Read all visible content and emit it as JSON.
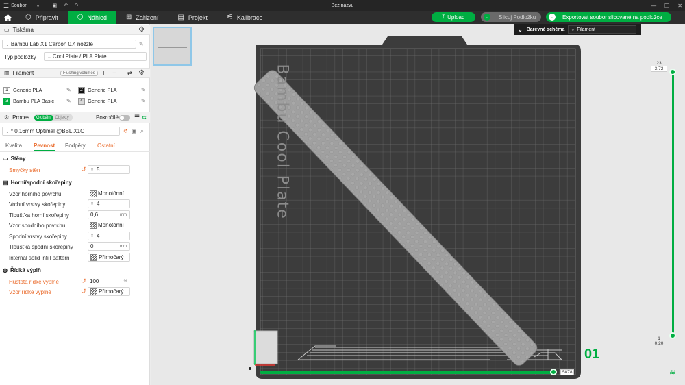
{
  "titlebar": {
    "menu_label": "Soubor",
    "title": "Bez názvu"
  },
  "tabs": [
    {
      "label": "Připravit",
      "icon": "prepare-icon"
    },
    {
      "label": "Náhled",
      "icon": "preview-icon"
    },
    {
      "label": "Zařízení",
      "icon": "device-icon"
    },
    {
      "label": "Projekt",
      "icon": "project-icon"
    },
    {
      "label": "Kalibrace",
      "icon": "calibration-icon"
    }
  ],
  "actions": {
    "upload": "Upload",
    "slice": "Slicuj Podložku",
    "export": "Exportovat soubor slicované na podložce"
  },
  "printer": {
    "section_title": "Tiskárna",
    "name": "Bambu Lab X1 Carbon 0.4 nozzle",
    "plate_label": "Typ podložky",
    "plate_value": "Cool Plate / PLA Plate"
  },
  "filament": {
    "section_title": "Filament",
    "flush_label": "Flushing volumes",
    "items": [
      {
        "num": "1",
        "name": "Generic PLA",
        "color": "#ffffff"
      },
      {
        "num": "2",
        "name": "Generic PLA",
        "color": "#111111"
      },
      {
        "num": "3",
        "name": "Bambu PLA Basic",
        "color": "#00ae42"
      },
      {
        "num": "4",
        "name": "Generic PLA",
        "color": "#d9d9d9"
      }
    ]
  },
  "process": {
    "section_title": "Proces",
    "toggle_global": "Globální",
    "toggle_objects": "Objekty",
    "advanced_label": "Pokročilé",
    "preset": "* 0.16mm Optimal @BBL X1C",
    "tabs": [
      "Kvalita",
      "Pevnost",
      "Podpěry",
      "Ostatní"
    ]
  },
  "settings": {
    "walls_title": "Stěny",
    "wall_loops_label": "Smyčky stěn",
    "wall_loops_value": "5",
    "shells_title": "Horní/spodní skořepiny",
    "top_pattern_label": "Vzor horního povrchu",
    "top_pattern_value": "Monotónní ...",
    "top_layers_label": "Vrchní vrstvy skořepiny",
    "top_layers_value": "4",
    "top_thickness_label": "Tloušťka horní skořepiny",
    "top_thickness_value": "0,6",
    "bottom_pattern_label": "Vzor spodního povrchu",
    "bottom_pattern_value": "Monotónní",
    "bottom_layers_label": "Spodní vrstvy skořepiny",
    "bottom_layers_value": "4",
    "bottom_thickness_label": "Tloušťka spodní skořepiny",
    "bottom_thickness_value": "0",
    "internal_solid_label": "Internal solid infill pattern",
    "internal_solid_value": "Přímočarý",
    "infill_title": "Řídká výplň",
    "density_label": "Hustota řídké výplně",
    "density_value": "100",
    "infill_pattern_label": "Vzor řídké výplně",
    "infill_pattern_value": "Přímočarý",
    "unit_mm": "mm",
    "unit_pct": "%"
  },
  "viewport": {
    "schema_label": "Barevné schéma",
    "schema_value": "Filament",
    "plate_text": "Bambu Cool Plate",
    "plate_number": "01",
    "layer_top": "23",
    "layer_top_height": "3.72",
    "layer_bottom": "1",
    "layer_bottom_height": "0.20",
    "move_value": "5878"
  }
}
